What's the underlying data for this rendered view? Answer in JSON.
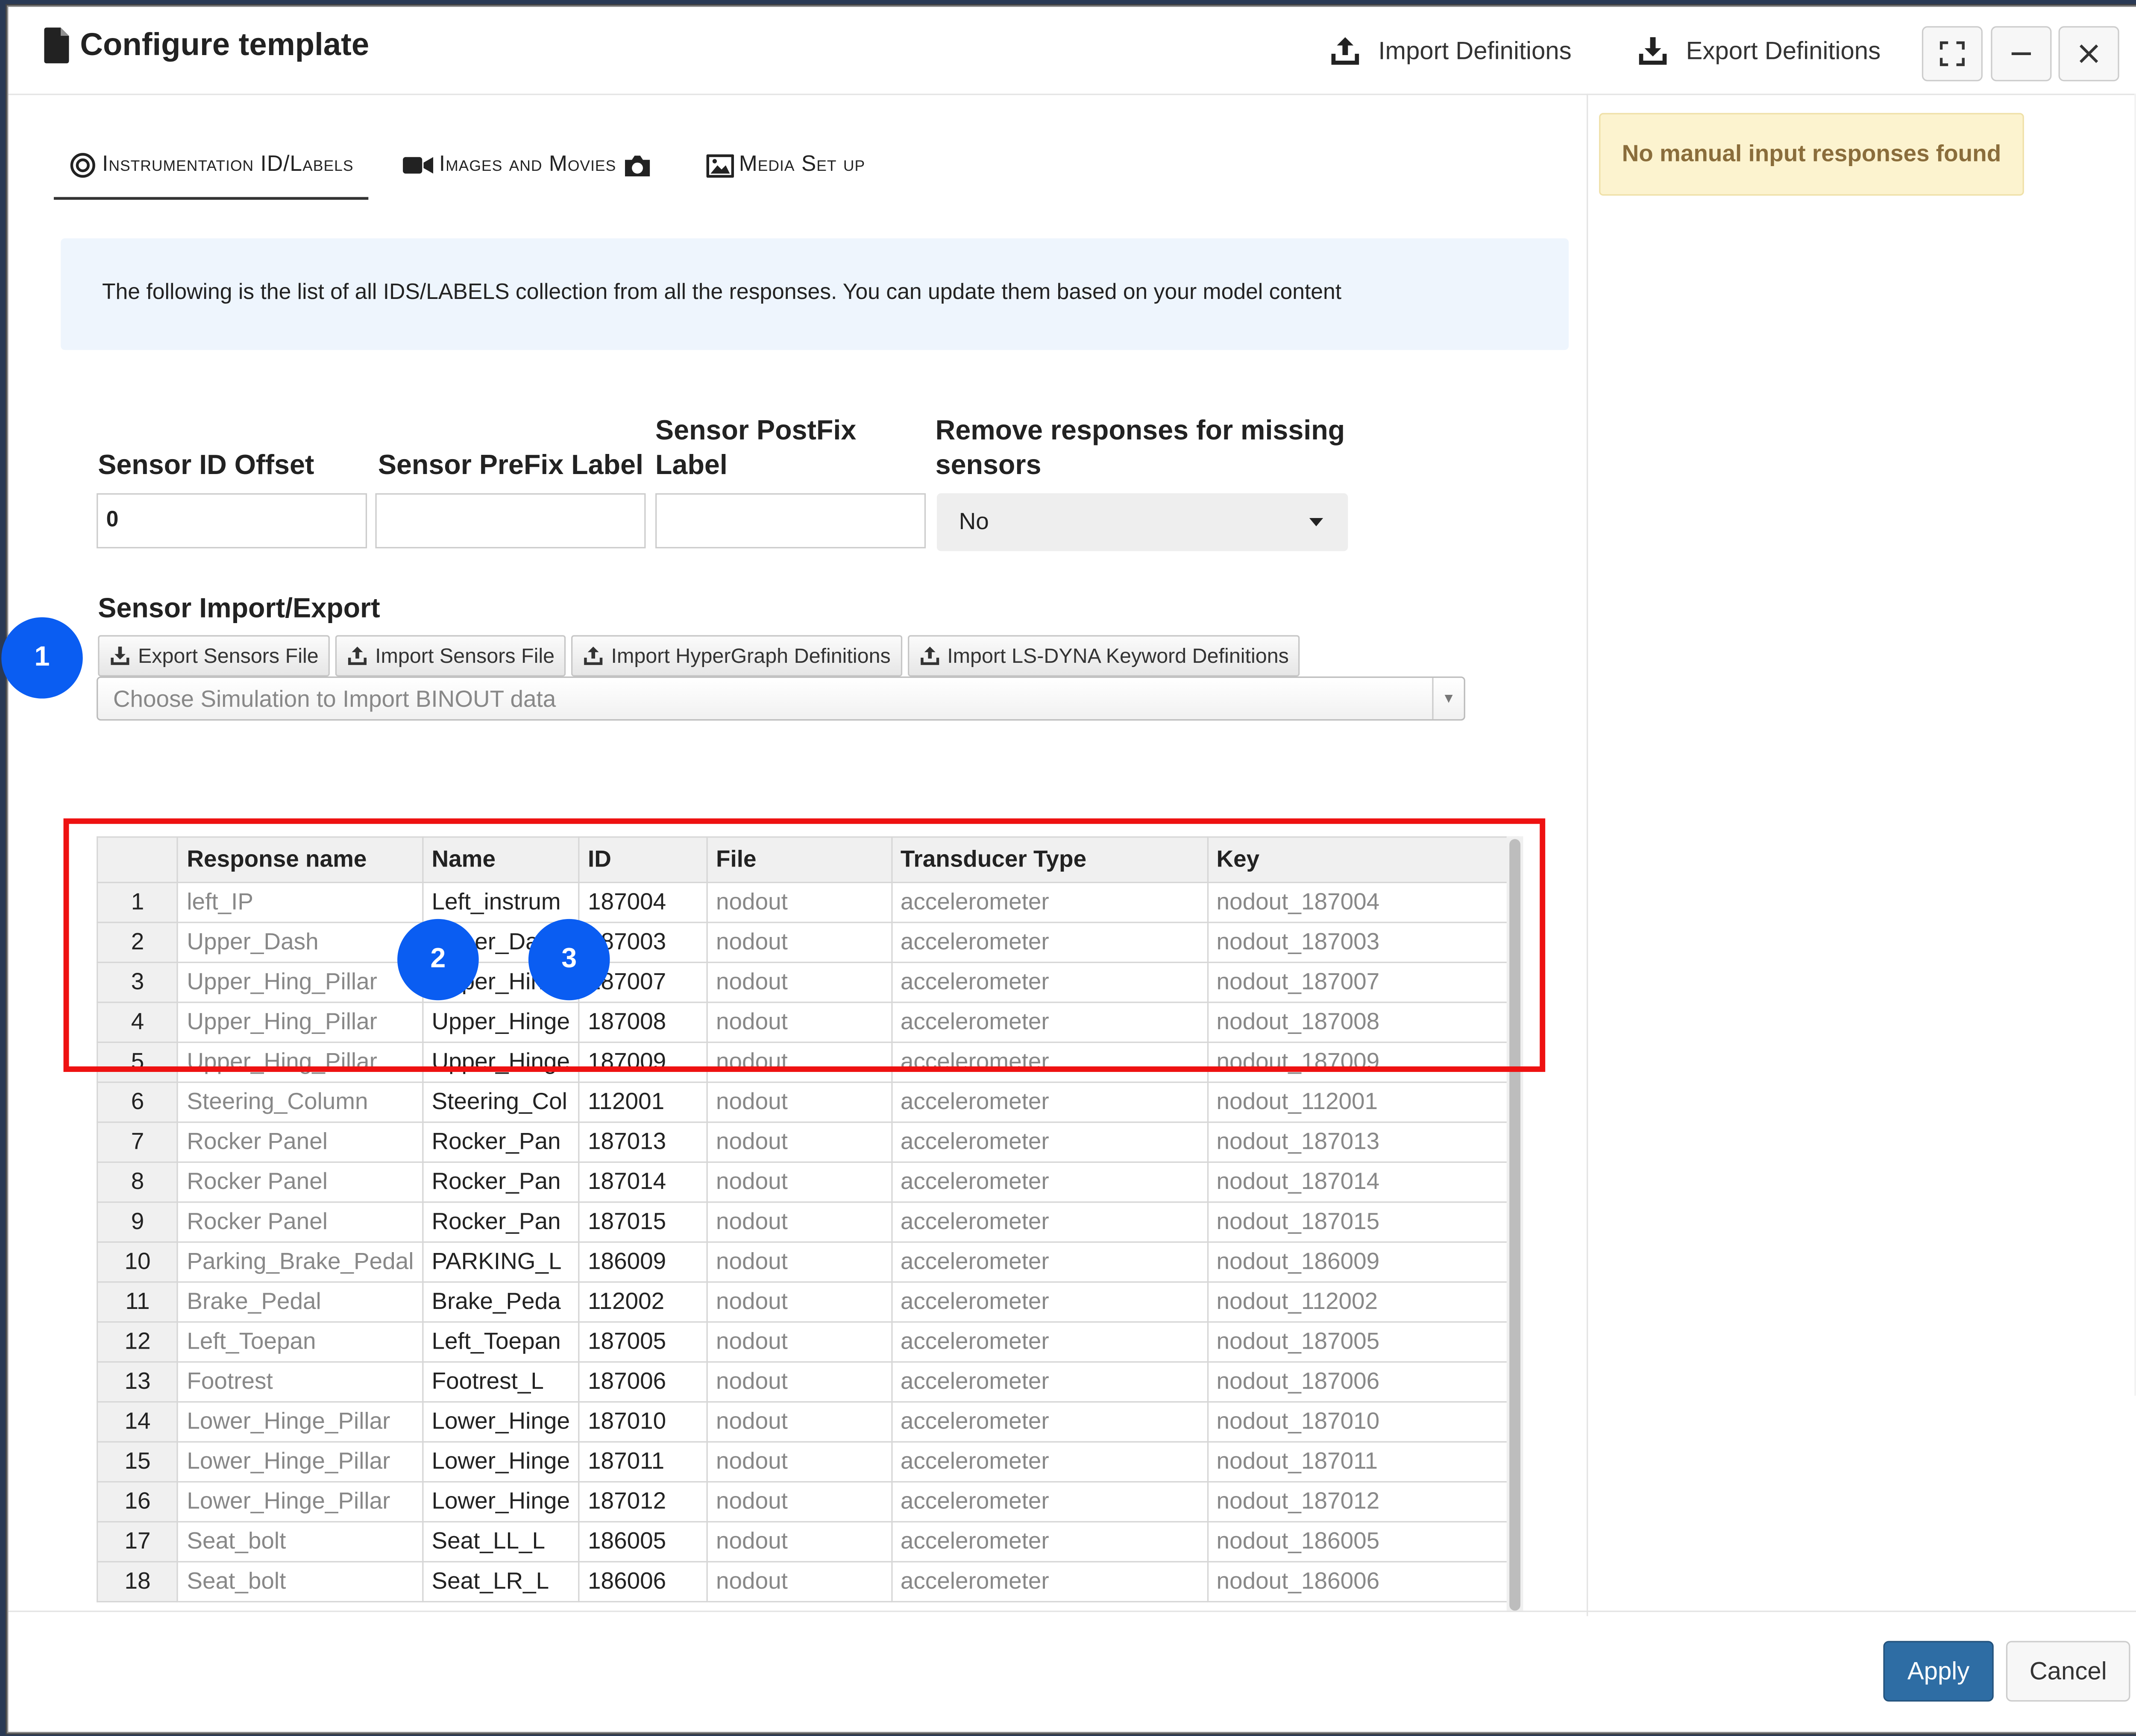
{
  "window": {
    "title": "Configure template",
    "import_definitions": "Import Definitions",
    "export_definitions": "Export Definitions"
  },
  "tabs": [
    {
      "label": "Instrumentation ID/Labels",
      "icon": "target-icon",
      "active": true
    },
    {
      "label": "Images and Movies",
      "icon": "video-camera-icon"
    },
    {
      "label": "Media Set up",
      "icon": "image-icon"
    }
  ],
  "info": "The following is the list of all IDS/LABELS collection from all the responses. You can update them based on your model content",
  "fields": {
    "offset_label": "Sensor ID Offset",
    "offset_value": "0",
    "prefix_label": "Sensor PreFix Label",
    "prefix_value": "",
    "postfix_label_line1": "Sensor PostFix",
    "postfix_label_line2": "Label",
    "postfix_value": "",
    "remove_label_line1": "Remove responses for missing",
    "remove_label_line2": "sensors",
    "remove_value": "No"
  },
  "sensor_import": {
    "label": "Sensor Import/Export",
    "buttons": [
      "Export Sensors File",
      "Import Sensors File",
      "Import HyperGraph Definitions",
      "Import LS-DYNA Keyword Definitions"
    ],
    "binout_placeholder": "Choose Simulation to Import BINOUT data"
  },
  "callouts": [
    "1",
    "2",
    "3"
  ],
  "table": {
    "columns": [
      "",
      "Response name",
      "Name",
      "ID",
      "File",
      "Transducer Type",
      "Key"
    ],
    "rows": [
      [
        "1",
        "left_IP",
        "Left_instrum",
        "187004",
        "nodout",
        "accelerometer",
        "nodout_187004"
      ],
      [
        "2",
        "Upper_Dash",
        "Upper_Dash",
        "187003",
        "nodout",
        "accelerometer",
        "nodout_187003"
      ],
      [
        "3",
        "Upper_Hing_Pillar",
        "Upper_Hinge",
        "187007",
        "nodout",
        "accelerometer",
        "nodout_187007"
      ],
      [
        "4",
        "Upper_Hing_Pillar",
        "Upper_Hinge",
        "187008",
        "nodout",
        "accelerometer",
        "nodout_187008"
      ],
      [
        "5",
        "Upper_Hing_Pillar",
        "Upper_Hinge",
        "187009",
        "nodout",
        "accelerometer",
        "nodout_187009"
      ],
      [
        "6",
        "Steering_Column",
        "Steering_Col",
        "112001",
        "nodout",
        "accelerometer",
        "nodout_112001"
      ],
      [
        "7",
        "Rocker Panel",
        "Rocker_Pan",
        "187013",
        "nodout",
        "accelerometer",
        "nodout_187013"
      ],
      [
        "8",
        "Rocker Panel",
        "Rocker_Pan",
        "187014",
        "nodout",
        "accelerometer",
        "nodout_187014"
      ],
      [
        "9",
        "Rocker Panel",
        "Rocker_Pan",
        "187015",
        "nodout",
        "accelerometer",
        "nodout_187015"
      ],
      [
        "10",
        "Parking_Brake_Pedal",
        "PARKING_L",
        "186009",
        "nodout",
        "accelerometer",
        "nodout_186009"
      ],
      [
        "11",
        "Brake_Pedal",
        "Brake_Peda",
        "112002",
        "nodout",
        "accelerometer",
        "nodout_112002"
      ],
      [
        "12",
        "Left_Toepan",
        "Left_Toepan",
        "187005",
        "nodout",
        "accelerometer",
        "nodout_187005"
      ],
      [
        "13",
        "Footrest",
        "Footrest_L",
        "187006",
        "nodout",
        "accelerometer",
        "nodout_187006"
      ],
      [
        "14",
        "Lower_Hinge_Pillar",
        "Lower_Hinge",
        "187010",
        "nodout",
        "accelerometer",
        "nodout_187010"
      ],
      [
        "15",
        "Lower_Hinge_Pillar",
        "Lower_Hinge",
        "187011",
        "nodout",
        "accelerometer",
        "nodout_187011"
      ],
      [
        "16",
        "Lower_Hinge_Pillar",
        "Lower_Hinge",
        "187012",
        "nodout",
        "accelerometer",
        "nodout_187012"
      ],
      [
        "17",
        "Seat_bolt",
        "Seat_LL_L",
        "186005",
        "nodout",
        "accelerometer",
        "nodout_186005"
      ],
      [
        "18",
        "Seat_bolt",
        "Seat_LR_L",
        "186006",
        "nodout",
        "accelerometer",
        "nodout_186006"
      ]
    ]
  },
  "warning": "No manual input responses found",
  "footer": {
    "apply": "Apply",
    "cancel": "Cancel"
  },
  "colors": {
    "primary": "#2e6da4",
    "callout": "#0a5df2",
    "highlight": "#ee1111",
    "warning_bg": "#fcf3cf"
  }
}
